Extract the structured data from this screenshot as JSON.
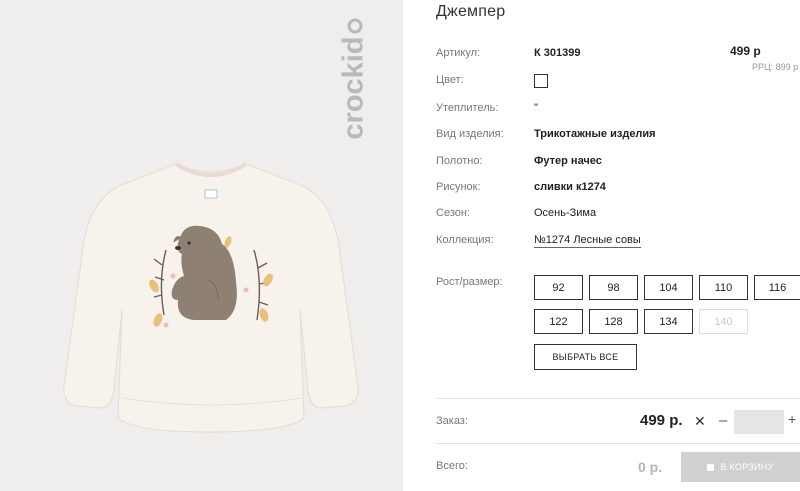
{
  "product": {
    "title": "Джемпер",
    "brand": "crockid"
  },
  "details": {
    "article": {
      "label": "Артикул:",
      "value": "К 301399"
    },
    "color": {
      "label": "Цвет:"
    },
    "insulation": {
      "label": "Утеплитель:",
      "value": "\""
    },
    "item_type": {
      "label": "Вид изделия:",
      "value": "Трикотажные изделия"
    },
    "fabric": {
      "label": "Полотно:",
      "value": "Футер начес"
    },
    "pattern": {
      "label": "Рисунок:",
      "value": "сливки к1274"
    },
    "season": {
      "label": "Сезон:",
      "value": "Осень-Зима"
    },
    "collection": {
      "label": "Коллекция:",
      "value": "№1274 Лесные совы"
    }
  },
  "price": {
    "value": "499 р",
    "rrp": "РРЦ: 899 р"
  },
  "sizes": {
    "label": "Рост/размер:",
    "options": [
      "92",
      "98",
      "104",
      "110",
      "116",
      "122",
      "128",
      "134",
      "140"
    ],
    "disabled": [
      "140"
    ],
    "select_all_label": "ВЫБРАТЬ ВСЕ"
  },
  "order": {
    "label": "Заказ:",
    "price": "499 р.",
    "remove_icon": "close-icon",
    "minus": "–",
    "plus": "+",
    "quantity": ""
  },
  "total": {
    "label": "Всего:",
    "value": "0 р.",
    "cart_button_label": "В КОРЗИНУ"
  },
  "colors": {
    "photo_bg": "#efeeed",
    "sweater": "#f7f3ec",
    "bear": "#8f8074",
    "disabled_button": "#d0d0d0"
  }
}
